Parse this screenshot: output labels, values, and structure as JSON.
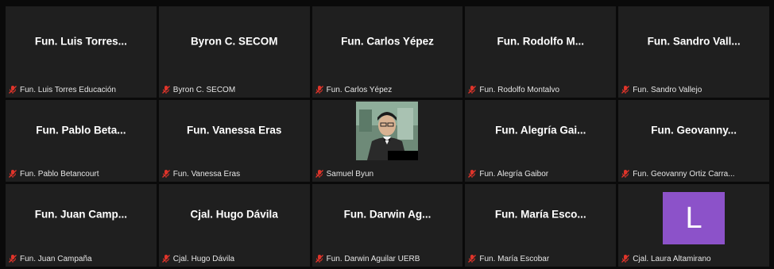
{
  "mic_icon": "mic-muted-icon",
  "colors": {
    "tile_bg": "#1f1f1f",
    "mic_muted": "#e0342a",
    "avatar_bg": "#8c52c9"
  },
  "participants": [
    {
      "display": "Fun. Luis Torres...",
      "label": "Fun. Luis Torres Educación"
    },
    {
      "display": "Byron C. SECOM",
      "label": "Byron C. SECOM"
    },
    {
      "display": "Fun. Carlos Yépez",
      "label": "Fun. Carlos Yépez"
    },
    {
      "display": "Fun. Rodolfo M...",
      "label": "Fun. Rodolfo Montalvo"
    },
    {
      "display": "Fun. Sandro Vall...",
      "label": "Fun. Sandro Vallejo"
    },
    {
      "display": "Fun. Pablo Beta...",
      "label": "Fun. Pablo Betancourt"
    },
    {
      "display": "Fun. Vanessa Eras",
      "label": "Fun. Vanessa Eras"
    },
    {
      "display": "",
      "label": "Samuel Byun"
    },
    {
      "display": "Fun. Alegría Gai...",
      "label": "Fun. Alegría Gaibor"
    },
    {
      "display": "Fun. Geovanny...",
      "label": "Fun. Geovanny Ortiz Carra..."
    },
    {
      "display": "Fun. Juan Camp...",
      "label": "Fun. Juan Campaña"
    },
    {
      "display": "Cjal. Hugo Dávila",
      "label": "Cjal. Hugo Dávila"
    },
    {
      "display": "Fun. Darwin Ag...",
      "label": "Fun. Darwin Aguilar UERB"
    },
    {
      "display": "Fun. María Esco...",
      "label": "Fun. María Escobar"
    },
    {
      "display": "",
      "label": "Cjal. Laura Altamirano",
      "avatar_letter": "L"
    }
  ]
}
